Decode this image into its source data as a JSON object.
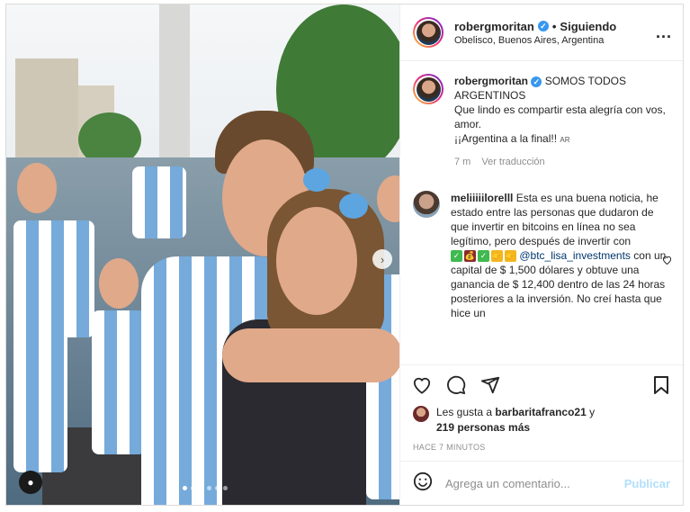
{
  "header": {
    "username": "robergmoritan",
    "verified_mark": "✓",
    "separator": "•",
    "follow_status": "Siguiendo",
    "location": "Obelisco, Buenos Aires, Argentina",
    "more_icon": "more-horizontal-icon",
    "more_label": "..."
  },
  "caption": {
    "username": "robergmoritan",
    "verified_mark": "✓",
    "line1": "SOMOS TODOS ARGENTINOS",
    "line2": "Que lindo es compartir esta alegría con vos, amor.",
    "line3": "¡¡Argentina a la final!!",
    "flag_emoji_text": "AR",
    "age": "7 m",
    "translate": "Ver traducción"
  },
  "comment": {
    "username": "meliiiiilorelll",
    "text_before": "Esta es una buena noticia, he estado entre las personas que dudaron de que invertir en bitcoins en línea no sea legítimo, pero después de invertir con",
    "emojis": [
      "✓",
      "💰",
      "✓",
      "👉",
      "👉"
    ],
    "mention": "@btc_lisa_investments",
    "text_after": "con un capital de $ 1,500 dólares y obtuve una ganancia de $ 12,400 dentro de las 24 horas posteriores a la inversión. No creí hasta que hice un"
  },
  "actions": {
    "like_icon": "heart-icon",
    "comment_icon": "comment-icon",
    "share_icon": "send-icon",
    "save_icon": "bookmark-icon"
  },
  "likes": {
    "prefix": "Les gusta a",
    "user": "barbaritafranco21",
    "joiner": "y",
    "others": "219 personas más"
  },
  "timestamp": "HACE 7 MINUTOS",
  "add_comment": {
    "placeholder": "Agrega un comentario...",
    "publish": "Publicar",
    "emoji_icon": "smiley-icon"
  },
  "photo": {
    "carousel_dots": 6,
    "active_dot": 1,
    "next_icon": "chevron-right-icon",
    "next_glyph": "›",
    "user_tag_icon": "user-tag-icon",
    "user_tag_glyph": "●"
  },
  "colors": {
    "link_blue": "#00376b",
    "verified_blue": "#3897f0",
    "publish_disabled": "#b2dffc",
    "argentina_sky_blue": "#75aadb"
  }
}
